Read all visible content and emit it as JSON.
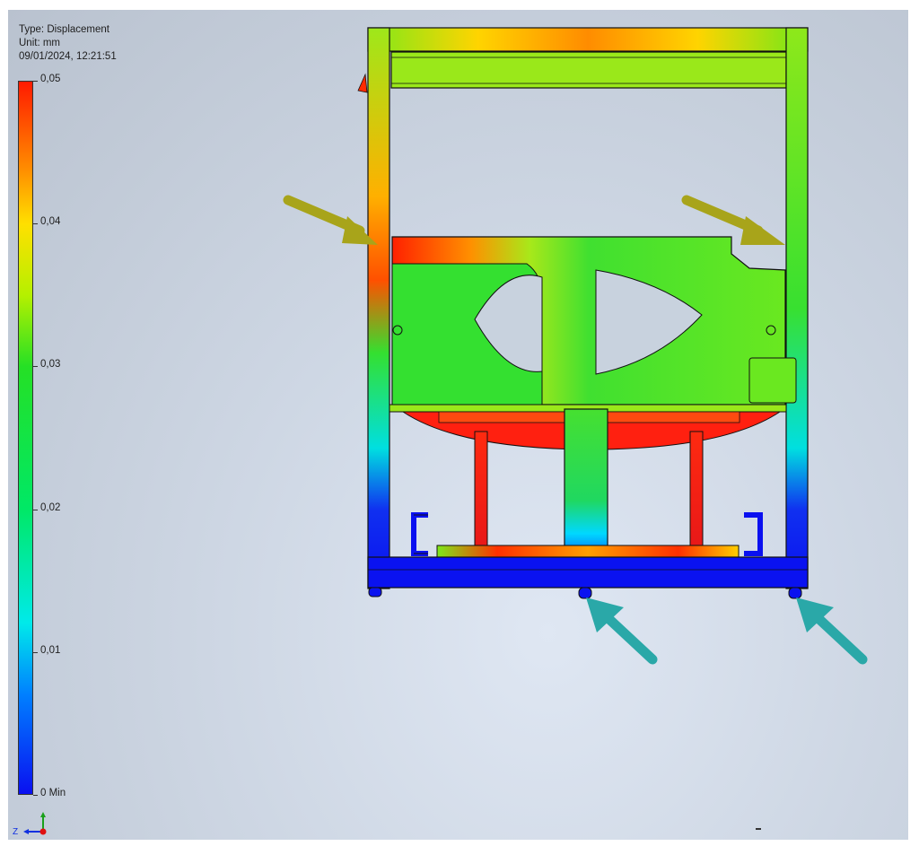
{
  "info": {
    "type_line": "Type: Displacement",
    "unit_line": "Unit: mm",
    "timestamp": "09/01/2024, 12:21:51"
  },
  "legend": {
    "ticks": [
      {
        "label": "0,05",
        "value": 0.05
      },
      {
        "label": "0,04",
        "value": 0.04
      },
      {
        "label": "0,03",
        "value": 0.03
      },
      {
        "label": "0,02",
        "value": 0.02
      },
      {
        "label": "0,01",
        "value": 0.01
      },
      {
        "label": "0 Min",
        "value": 0
      }
    ],
    "colors": [
      "#ff1a00",
      "#ff8a00",
      "#ffe000",
      "#25e025",
      "#00eaea",
      "#0a10f0"
    ]
  },
  "triad": {
    "z_label": "Z",
    "y_axis_color": "#1aa01a",
    "x_axis_color": "#e01010",
    "z_axis_color": "#1030e0"
  },
  "annotations": {
    "load_arrow_color": "#a8a41a",
    "constraint_arrow_color": "#2aa8a8"
  },
  "model": {
    "icons": [
      "displacement-contour",
      "frame-model"
    ]
  }
}
